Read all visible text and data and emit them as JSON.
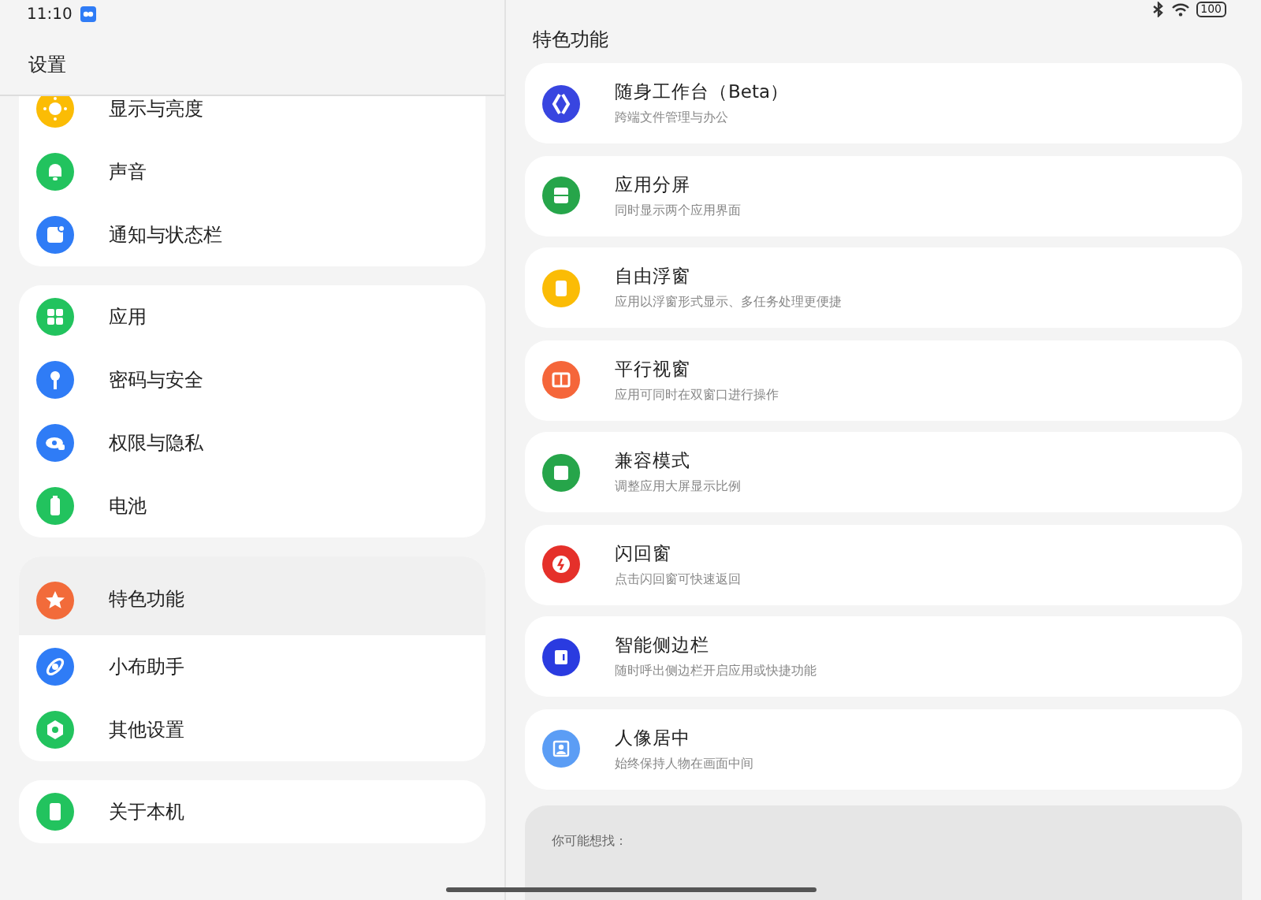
{
  "status_bar": {
    "time": "11:10",
    "battery": "100"
  },
  "sidebar": {
    "title": "设置",
    "groups": [
      {
        "items": [
          {
            "label": "显示与亮度",
            "color": "#fbbc05",
            "selected": false
          },
          {
            "label": "声音",
            "color": "#22c35e",
            "selected": false
          },
          {
            "label": "通知与状态栏",
            "color": "#2f7cf6",
            "selected": false
          }
        ]
      },
      {
        "items": [
          {
            "label": "应用",
            "color": "#22c35e",
            "selected": false
          },
          {
            "label": "密码与安全",
            "color": "#2f7cf6",
            "selected": false
          },
          {
            "label": "权限与隐私",
            "color": "#2f7cf6",
            "selected": false
          },
          {
            "label": "电池",
            "color": "#22c35e",
            "selected": false
          }
        ]
      },
      {
        "items": [
          {
            "label": "特色功能",
            "color": "#f26b3a",
            "selected": true
          },
          {
            "label": "小布助手",
            "color": "#2f7cf6",
            "selected": false
          },
          {
            "label": "其他设置",
            "color": "#22c35e",
            "selected": false
          }
        ]
      },
      {
        "items": [
          {
            "label": "关于本机",
            "color": "#22c35e",
            "selected": false
          }
        ]
      }
    ]
  },
  "detail": {
    "title": "特色功能",
    "features": [
      {
        "title": "随身工作台（Beta）",
        "subtitle": "跨端文件管理与办公",
        "color": "#3845e0"
      },
      {
        "title": "应用分屏",
        "subtitle": "同时显示两个应用界面",
        "color": "#26a54a"
      },
      {
        "title": "自由浮窗",
        "subtitle": "应用以浮窗形式显示、多任务处理更便捷",
        "color": "#fbbc05"
      },
      {
        "title": "平行视窗",
        "subtitle": "应用可同时在双窗口进行操作",
        "color": "#f5663a"
      },
      {
        "title": "兼容模式",
        "subtitle": "调整应用大屏显示比例",
        "color": "#26a54a"
      },
      {
        "title": "闪回窗",
        "subtitle": "点击闪回窗可快速返回",
        "color": "#e5302a"
      },
      {
        "title": "智能侧边栏",
        "subtitle": "随时呼出侧边栏开启应用或快捷功能",
        "color": "#2a3be0"
      },
      {
        "title": "人像居中",
        "subtitle": "始终保持人物在画面中间",
        "color": "#5b9df5"
      }
    ],
    "suggestions": {
      "title": "你可能想找："
    }
  }
}
